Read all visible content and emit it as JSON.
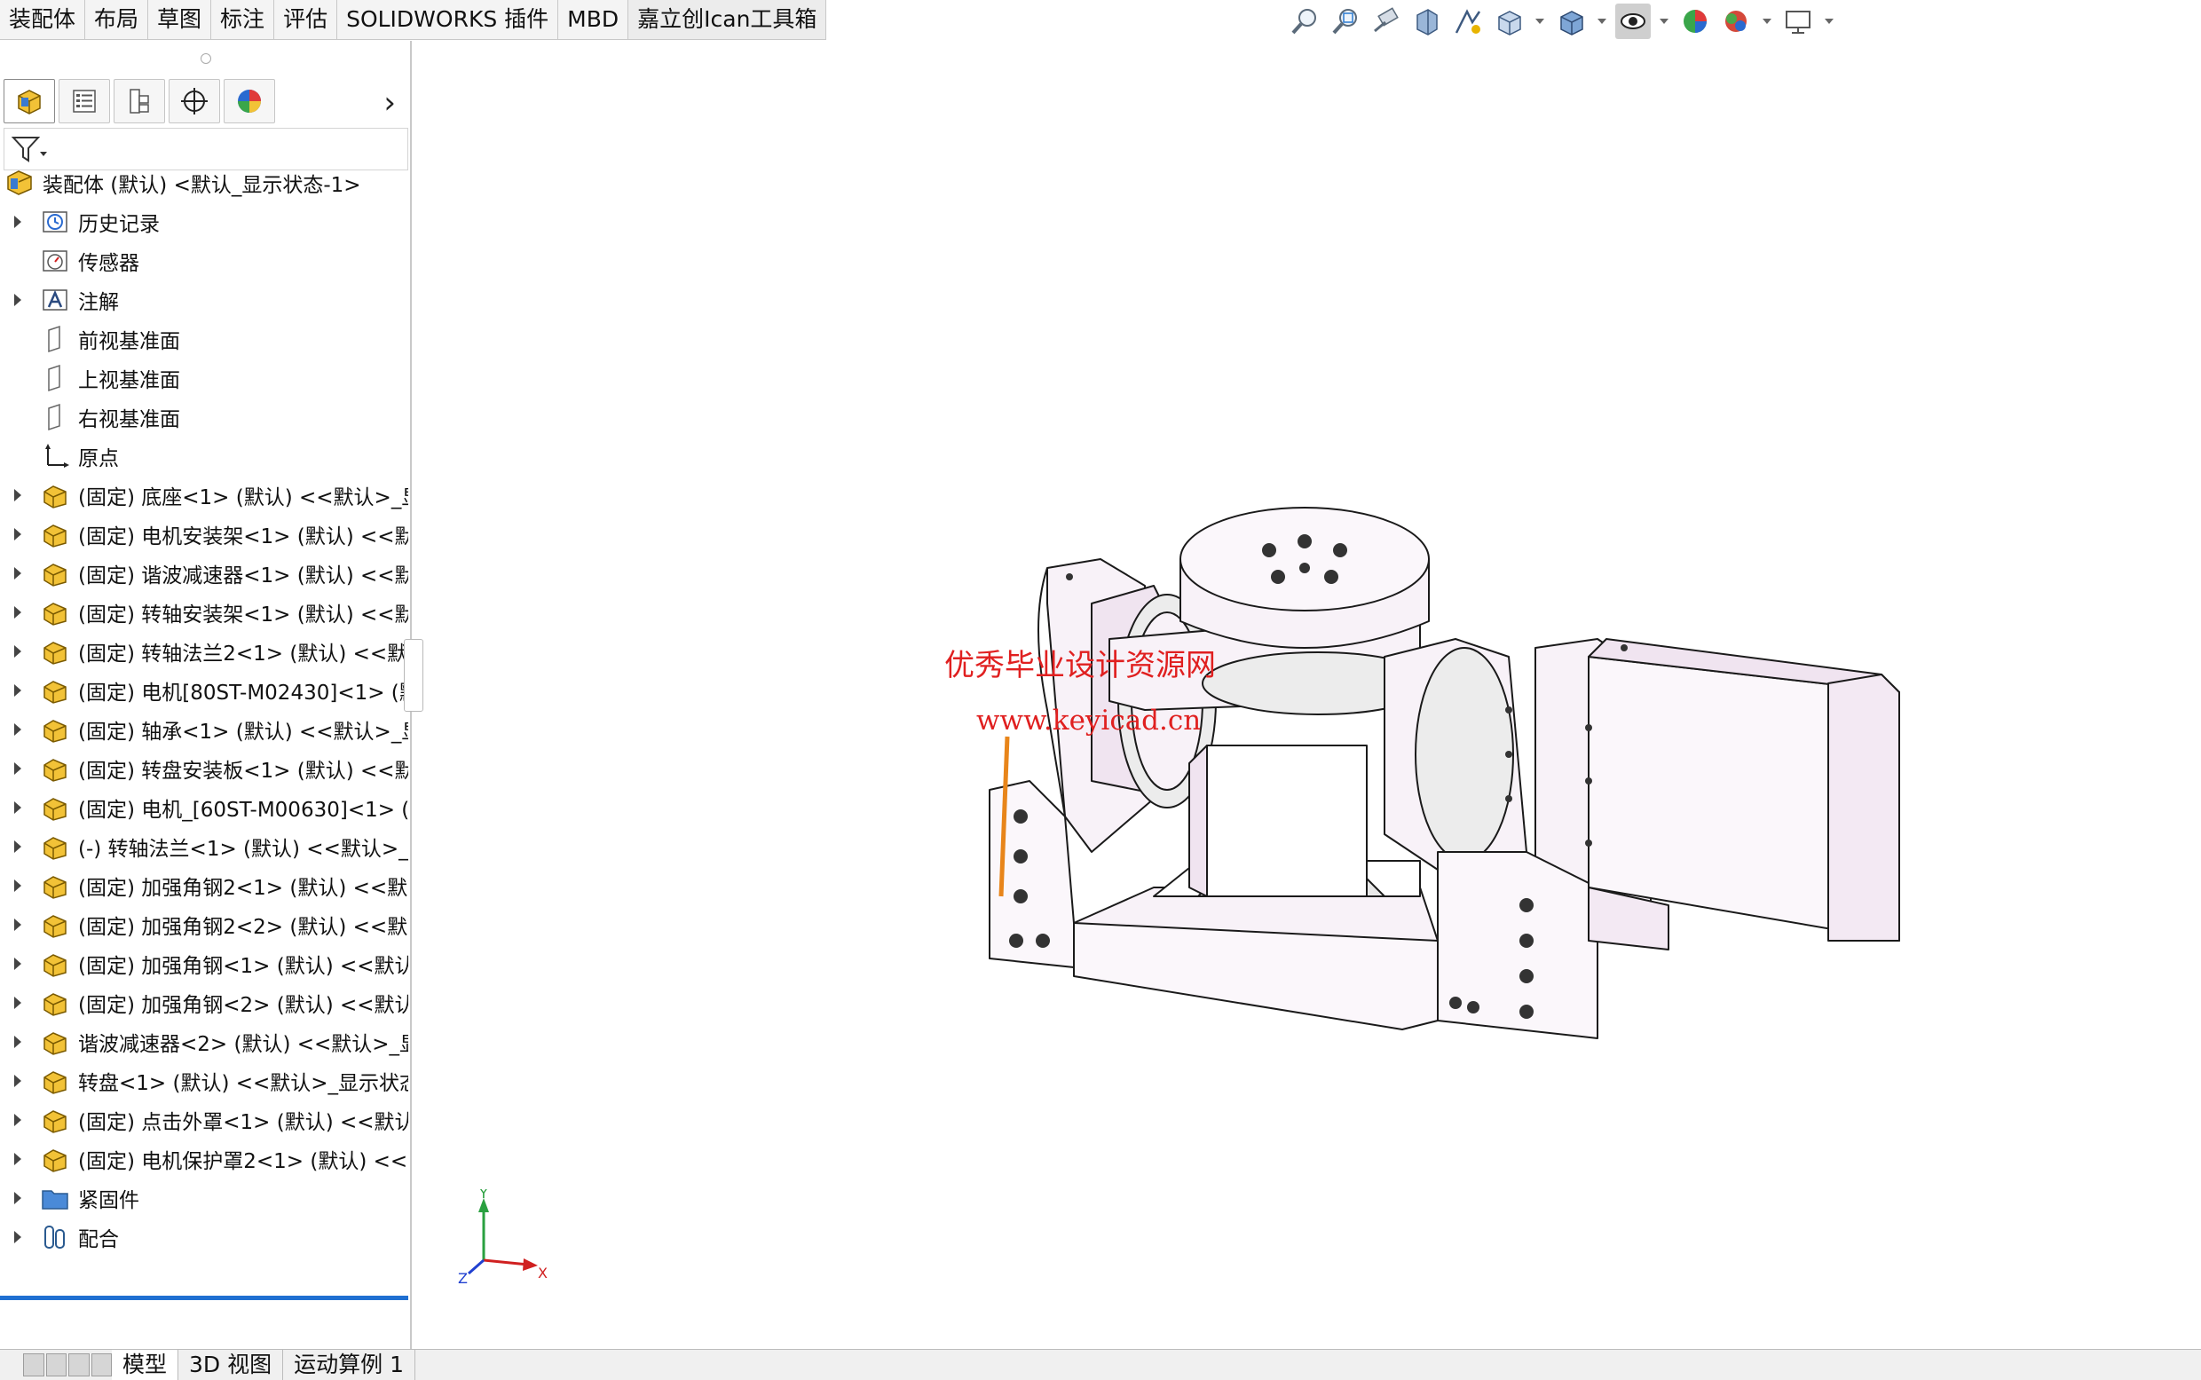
{
  "command_tabs": [
    "装配体",
    "布局",
    "草图",
    "标注",
    "评估",
    "SOLIDWORKS 插件",
    "MBD",
    "嘉立创Ican工具箱"
  ],
  "active_command_tab": "嘉立创Ican工具箱",
  "view_toolbar": {
    "icons": [
      "zoom-to-fit-icon",
      "zoom-to-area-icon",
      "previous-view-icon",
      "section-view-icon",
      "dynamic-annotation-icon",
      "view-orientation-icon",
      "display-style-icon",
      "hide-show-items-icon",
      "edit-appearance-icon",
      "apply-scene-icon",
      "view-settings-icon"
    ]
  },
  "manager_tabs": [
    "featuremanager-icon",
    "propertymanager-icon",
    "configurationmanager-icon",
    "dimxpert-icon",
    "displaymanager-icon"
  ],
  "tree": {
    "root": "装配体 (默认) <默认_显示状态-1>",
    "items": [
      {
        "label": "历史记录",
        "icon": "history",
        "expandable": true
      },
      {
        "label": "传感器",
        "icon": "sensor",
        "expandable": false
      },
      {
        "label": "注解",
        "icon": "annotation",
        "expandable": true
      },
      {
        "label": "前视基准面",
        "icon": "plane",
        "expandable": false
      },
      {
        "label": "上视基准面",
        "icon": "plane",
        "expandable": false
      },
      {
        "label": "右视基准面",
        "icon": "plane",
        "expandable": false
      },
      {
        "label": "原点",
        "icon": "origin",
        "expandable": false
      },
      {
        "label": "(固定) 底座<1> (默认) <<默认>_显",
        "icon": "part",
        "expandable": true
      },
      {
        "label": "(固定) 电机安装架<1> (默认) <<默",
        "icon": "part",
        "expandable": true
      },
      {
        "label": "(固定) 谐波减速器<1> (默认) <<默",
        "icon": "part",
        "expandable": true
      },
      {
        "label": "(固定) 转轴安装架<1> (默认) <<默",
        "icon": "part",
        "expandable": true
      },
      {
        "label": "(固定) 转轴法兰2<1> (默认) <<默",
        "icon": "part",
        "expandable": true
      },
      {
        "label": "(固定) 电机[80ST-M02430]<1> (默",
        "icon": "part",
        "expandable": true
      },
      {
        "label": "(固定) 轴承<1> (默认) <<默认>_显",
        "icon": "part",
        "expandable": true
      },
      {
        "label": "(固定) 转盘安装板<1> (默认) <<默",
        "icon": "part",
        "expandable": true
      },
      {
        "label": "(固定) 电机_[60ST-M00630]<1> (",
        "icon": "part",
        "expandable": true
      },
      {
        "label": "(-) 转轴法兰<1> (默认) <<默认>_",
        "icon": "part",
        "expandable": true
      },
      {
        "label": "(固定) 加强角钢2<1> (默认) <<默",
        "icon": "part",
        "expandable": true
      },
      {
        "label": "(固定) 加强角钢2<2> (默认) <<默",
        "icon": "part",
        "expandable": true
      },
      {
        "label": "(固定) 加强角钢<1> (默认) <<默认",
        "icon": "part",
        "expandable": true
      },
      {
        "label": "(固定) 加强角钢<2> (默认) <<默认",
        "icon": "part",
        "expandable": true
      },
      {
        "label": "谐波减速器<2> (默认) <<默认>_显",
        "icon": "part",
        "expandable": true
      },
      {
        "label": "转盘<1> (默认) <<默认>_显示状态",
        "icon": "part",
        "expandable": true
      },
      {
        "label": "(固定) 点击外罩<1> (默认) <<默认",
        "icon": "part",
        "expandable": true
      },
      {
        "label": "(固定) 电机保护罩2<1> (默认) <<!",
        "icon": "part",
        "expandable": true
      },
      {
        "label": "紧固件",
        "icon": "folder",
        "expandable": true
      },
      {
        "label": "配合",
        "icon": "mates",
        "expandable": true
      }
    ]
  },
  "bottom_tabs": [
    "模型",
    "3D 视图",
    "运动算例 1"
  ],
  "active_bottom_tab": "模型",
  "watermark": {
    "line1": "优秀毕业设计资源网",
    "line2": "www.keyicad.cn"
  },
  "triad": {
    "x": "X",
    "y": "Y",
    "z": "Z"
  },
  "colors": {
    "accent": "#1f6fd1",
    "watermark": "#e02020",
    "part_fill": "#f3e9f3"
  }
}
